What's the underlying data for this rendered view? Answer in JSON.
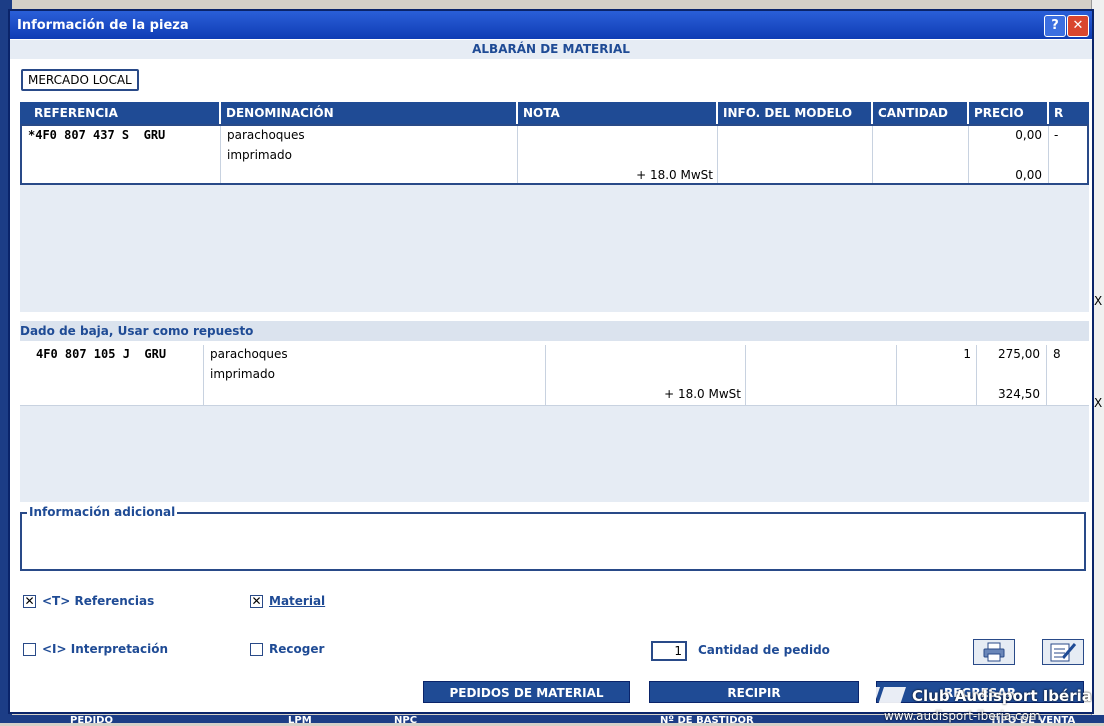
{
  "dialog": {
    "title": "Información de la pieza",
    "help_label": "?",
    "close_label": "✕",
    "doc_title": "ALBARÁN DE MATERIAL",
    "market_label": "MERCADO LOCAL"
  },
  "columns": [
    "REFERENCIA",
    "DENOMINACIÓN",
    "NOTA",
    "INFO. DEL MODELO",
    "CANTIDAD",
    "PRECIO",
    "R"
  ],
  "row1": {
    "reference": "*4F0 807 437 S  GRU",
    "name_line1": "parachoques",
    "name_line2": "imprimado",
    "note": "+ 18.0 MwSt",
    "model_info": "",
    "quantity": "",
    "price": "0,00",
    "price_total": "0,00",
    "r": "-"
  },
  "section2_title": "Dado de baja, Usar como repuesto",
  "row2": {
    "reference": "4F0 807 105 J  GRU",
    "name_line1": "parachoques",
    "name_line2": "imprimado",
    "note": "+ 18.0 MwSt",
    "model_info": "",
    "quantity": "1",
    "price": "275,00",
    "price_total": "324,50",
    "r": "8"
  },
  "info_section": {
    "legend": "Información adicional",
    "text": ""
  },
  "options": {
    "references_label": "<T> Referencias",
    "references_checked": true,
    "material_label": "Material",
    "material_checked": true,
    "interpretation_label": "<I> Interpretación",
    "interpretation_checked": false,
    "collect_label": "Recoger",
    "collect_checked": false
  },
  "order_qty": {
    "value": "1",
    "label": "Cantidad de pedido"
  },
  "icons": {
    "print": "printer-icon",
    "edit": "edit-notepad-icon"
  },
  "buttons": {
    "material_orders": "PEDIDOS DE MATERIAL",
    "receive": "RECIPIR",
    "back": "REGRESAR"
  },
  "background": {
    "x_mark_1": "X",
    "x_mark_2": "X",
    "strip_labels": [
      "PEDIDO",
      "LPM",
      "NPC",
      "Nº DE BASTIDOR",
      "TIPO DE VENTA"
    ]
  },
  "watermark": {
    "name": "Club Audisport Ibéria",
    "url": "www.audisport-iberia.com"
  }
}
